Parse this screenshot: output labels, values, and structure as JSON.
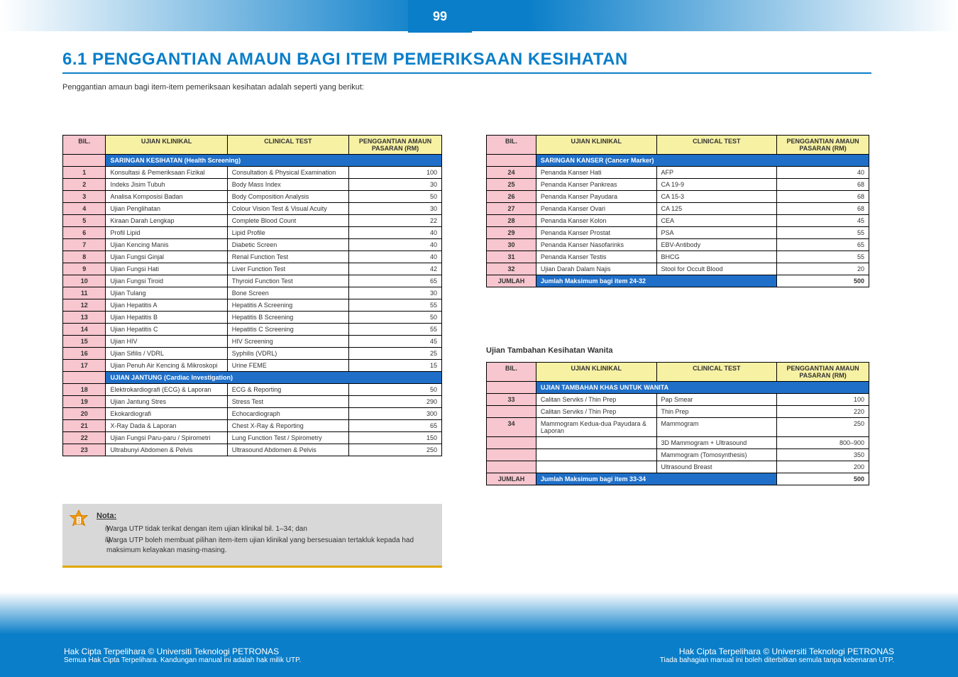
{
  "page_number": "99",
  "section_title": "6.1 PENGGANTIAN AMAUN BAGI ITEM PEMERIKSAAN KESIHATAN",
  "intro": "Penggantian amaun bagi item-item pemeriksaan kesihatan adalah seperti yang berikut:",
  "table1": {
    "headers": [
      "BIL.",
      "UJIAN KLINIKAL",
      "CLINICAL TEST",
      "PENGGANTIAN AMAUN PASARAN (RM)"
    ],
    "section1_title": "SARINGAN KESIHATAN (Health Screening)",
    "section2_title": "UJIAN JANTUNG (Cardiac Investigation)",
    "rows1": [
      [
        "1",
        "Konsultasi & Pemeriksaan Fizikal",
        "Consultation & Physical Examination",
        "100"
      ],
      [
        "2",
        "Indeks Jisim Tubuh",
        "Body Mass Index",
        "30"
      ],
      [
        "3",
        "Analisa Komposisi Badan",
        "Body Composition Analysis",
        "50"
      ],
      [
        "4",
        "Ujian Penglihatan",
        "Colour Vision Test & Visual Acuity",
        "30"
      ],
      [
        "5",
        "Kiraan Darah Lengkap",
        "Complete Blood Count",
        "22"
      ],
      [
        "6",
        "Profil Lipid",
        "Lipid Profile",
        "40"
      ],
      [
        "7",
        "Ujian Kencing Manis",
        "Diabetic Screen",
        "40"
      ],
      [
        "8",
        "Ujian Fungsi Ginjal",
        "Renal Function Test",
        "40"
      ],
      [
        "9",
        "Ujian Fungsi Hati",
        "Liver Function Test",
        "42"
      ],
      [
        "10",
        "Ujian Fungsi Tiroid",
        "Thyroid Function Test",
        "65"
      ],
      [
        "11",
        "Ujian Tulang",
        "Bone Screen",
        "30"
      ],
      [
        "12",
        "Ujian Hepatitis A",
        "Hepatitis A Screening",
        "55"
      ],
      [
        "13",
        "Ujian Hepatitis B",
        "Hepatitis B Screening",
        "50"
      ],
      [
        "14",
        "Ujian Hepatitis C",
        "Hepatitis C Screening",
        "55"
      ],
      [
        "15",
        "Ujian HIV",
        "HIV Screening",
        "45"
      ],
      [
        "16",
        "Ujian Siﬁlis / VDRL",
        "Syphilis (VDRL)",
        "25"
      ],
      [
        "17",
        "Ujian Penuh Air Kencing & Mikroskopi",
        "Urine FEME",
        "15"
      ]
    ],
    "rows2": [
      [
        "18",
        "Elektrokardiografi (ECG) & Laporan",
        "ECG & Reporting",
        "50"
      ],
      [
        "19",
        "Ujian Jantung Stres",
        "Stress Test",
        "290"
      ],
      [
        "20",
        "Ekokardiografi",
        "Echocardiograph",
        "300"
      ],
      [
        "21",
        "X-Ray Dada & Laporan",
        "Chest X-Ray & Reporting",
        "65"
      ],
      [
        "22",
        "Ujian Fungsi Paru-paru / Spirometri",
        "Lung Function Test / Spirometry",
        "150"
      ],
      [
        "23",
        "Ultrabunyi Abdomen & Pelvis",
        "Ultrasound Abdomen & Pelvis",
        "250"
      ]
    ]
  },
  "table2": {
    "headers": [
      "BIL.",
      "UJIAN KLINIKAL",
      "CLINICAL TEST",
      "PENGGANTIAN AMAUN PASARAN (RM)"
    ],
    "section_title": "SARINGAN KANSER (Cancer Marker)",
    "jumlah_label": "JUMLAH",
    "jumlah_value": "500",
    "rows": [
      [
        "24",
        "Penanda Kanser Hati",
        "AFP",
        "40"
      ],
      [
        "25",
        "Penanda Kanser Pankreas",
        "CA 19-9",
        "68"
      ],
      [
        "26",
        "Penanda Kanser Payudara",
        "CA 15-3",
        "68"
      ],
      [
        "27",
        "Penanda Kanser Ovari",
        "CA 125",
        "68"
      ],
      [
        "28",
        "Penanda Kanser Kolon",
        "CEA",
        "45"
      ],
      [
        "29",
        "Penanda Kanser Prostat",
        "PSA",
        "55"
      ],
      [
        "30",
        "Penanda Kanser Nasofarinks",
        "EBV-Antibody",
        "65"
      ],
      [
        "31",
        "Penanda Kanser Testis",
        "BHCG",
        "55"
      ],
      [
        "32",
        "Ujian Darah Dalam Najis",
        "Stool for Occult Blood",
        "20"
      ]
    ],
    "jumlah_note": "Jumlah Maksimum bagi item 24-32"
  },
  "table3_title": "Ujian Tambahan Kesihatan Wanita",
  "table3": {
    "headers": [
      "BIL.",
      "UJIAN KLINIKAL",
      "CLINICAL TEST",
      "PENGGANTIAN AMAUN PASARAN (RM)"
    ],
    "section_title": "UJIAN TAMBAHAN KHAS UNTUK WANITA",
    "rows": [
      [
        "33",
        "Calitan Serviks / Thin Prep",
        "Pap Smear",
        "100"
      ],
      [
        "",
        "Calitan Serviks / Thin Prep",
        "Thin Prep",
        "220"
      ],
      [
        "34",
        "Mammogram Kedua-dua Payudara & Laporan",
        "Mammogram",
        "250"
      ],
      [
        "",
        "",
        "3D Mammogram + Ultrasound",
        "800–900"
      ],
      [
        "",
        "",
        "Mammogram (Tomosynthesis)",
        "350"
      ],
      [
        "",
        "",
        "Ultrasound Breast",
        "200"
      ]
    ],
    "jumlah_label": "JUMLAH",
    "jumlah_note": "Jumlah Maksimum bagi item 33-34",
    "jumlah_value": "500"
  },
  "note": {
    "title": "Nota:",
    "lines": [
      "Warga UTP tidak terikat dengan item ujian klinikal bil. 1–34; dan",
      "Warga UTP boleh membuat pilihan item-item ujian klinikal yang bersesuaian tertakluk kepada had maksimum kelayakan masing-masing."
    ]
  },
  "footer": {
    "left1": "Hak Cipta Terpelihara © Universiti Teknologi PETRONAS",
    "left2": "Semua Hak Cipta Terpelihara. Kandungan manual ini adalah hak milik UTP.",
    "right1": "Hak Cipta Terpelihara © Universiti Teknologi PETRONAS",
    "right2": "Tiada bahagian manual ini boleh diterbitkan semula tanpa kebenaran UTP."
  }
}
